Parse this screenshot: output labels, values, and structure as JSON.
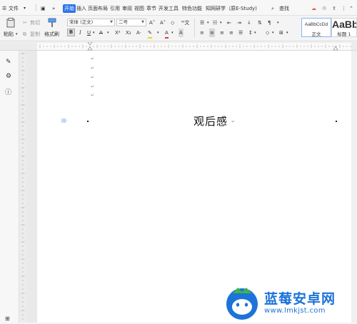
{
  "menubar": {
    "menu_label": "文件",
    "tabs": [
      "开始",
      "插入",
      "页面布局",
      "引用",
      "审阅",
      "视图",
      "章节",
      "开发工具",
      "特色功能",
      "知网研学（原E-Study)"
    ],
    "active_tab": "开始",
    "search_label": "查找"
  },
  "ribbon": {
    "paste_label": "粘贴",
    "cut_label": "剪切",
    "copy_label": "复制",
    "format_painter_label": "格式刷",
    "font_name": "宋体 (正文)",
    "font_size": "二号",
    "styles": [
      {
        "preview": "AaBbCcDd",
        "name": "正文"
      },
      {
        "preview": "AaBb",
        "name": "标题 1"
      }
    ]
  },
  "document": {
    "title": "观后感",
    "paragraph_mark": "↵",
    "empty_paragraph_count": 5
  },
  "watermark": {
    "name": "蓝莓安卓网",
    "url": "www.lmkjst.com"
  },
  "colors": {
    "accent": "#2a73e8",
    "watermark_blue": "#1d73d8",
    "font_color_red": "#e03a3a",
    "highlight_yellow": "#f2d31b"
  }
}
